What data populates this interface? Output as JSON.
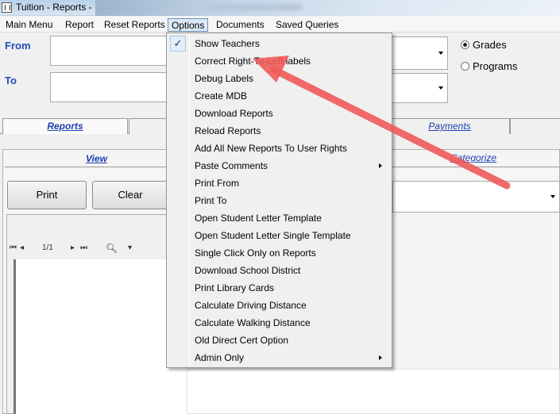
{
  "window": {
    "title": "Tuition - Reports -"
  },
  "menubar": {
    "items": [
      {
        "label": "Main Menu"
      },
      {
        "label": "Report"
      },
      {
        "label": "Reset Reports"
      },
      {
        "label": "Options"
      },
      {
        "label": "Documents"
      },
      {
        "label": "Saved Queries"
      }
    ]
  },
  "form": {
    "from_label": "From",
    "to_label": "To",
    "radios": [
      {
        "label": "Grades",
        "checked": true
      },
      {
        "label": "Programs",
        "checked": false
      }
    ]
  },
  "tabs": {
    "reports": "Reports",
    "payments": "Payments",
    "view": "View",
    "categorize": "Categorize"
  },
  "buttons": {
    "print": "Print",
    "clear": "Clear"
  },
  "viewer": {
    "page_indicator": "1/1"
  },
  "options_menu": {
    "items": [
      {
        "label": "Show Teachers",
        "checked": true,
        "submenu": false
      },
      {
        "label": "Correct Right-To-Left labels",
        "checked": false,
        "submenu": false
      },
      {
        "label": "Debug Labels",
        "checked": false,
        "submenu": false
      },
      {
        "label": "Create MDB",
        "checked": false,
        "submenu": false
      },
      {
        "label": "Download Reports",
        "checked": false,
        "submenu": false
      },
      {
        "label": "Reload Reports",
        "checked": false,
        "submenu": false
      },
      {
        "label": "Add All New Reports To User Rights",
        "checked": false,
        "submenu": false
      },
      {
        "label": "Paste Comments",
        "checked": false,
        "submenu": true
      },
      {
        "label": "Print From",
        "checked": false,
        "submenu": false
      },
      {
        "label": "Print To",
        "checked": false,
        "submenu": false
      },
      {
        "label": "Open Student Letter Template",
        "checked": false,
        "submenu": false
      },
      {
        "label": "Open Student Letter Single Template",
        "checked": false,
        "submenu": false
      },
      {
        "label": "Single Click Only on Reports",
        "checked": false,
        "submenu": false
      },
      {
        "label": "Download School District",
        "checked": false,
        "submenu": false
      },
      {
        "label": "Print Library Cards",
        "checked": false,
        "submenu": false
      },
      {
        "label": "Calculate Driving Distance",
        "checked": false,
        "submenu": false
      },
      {
        "label": "Calculate Walking Distance",
        "checked": false,
        "submenu": false
      },
      {
        "label": "Old Direct Cert Option",
        "checked": false,
        "submenu": false
      },
      {
        "label": "Admin Only",
        "checked": false,
        "submenu": true
      }
    ]
  },
  "colors": {
    "annotation_arrow": "#f05a5a",
    "link_blue": "#1c3fb0"
  }
}
